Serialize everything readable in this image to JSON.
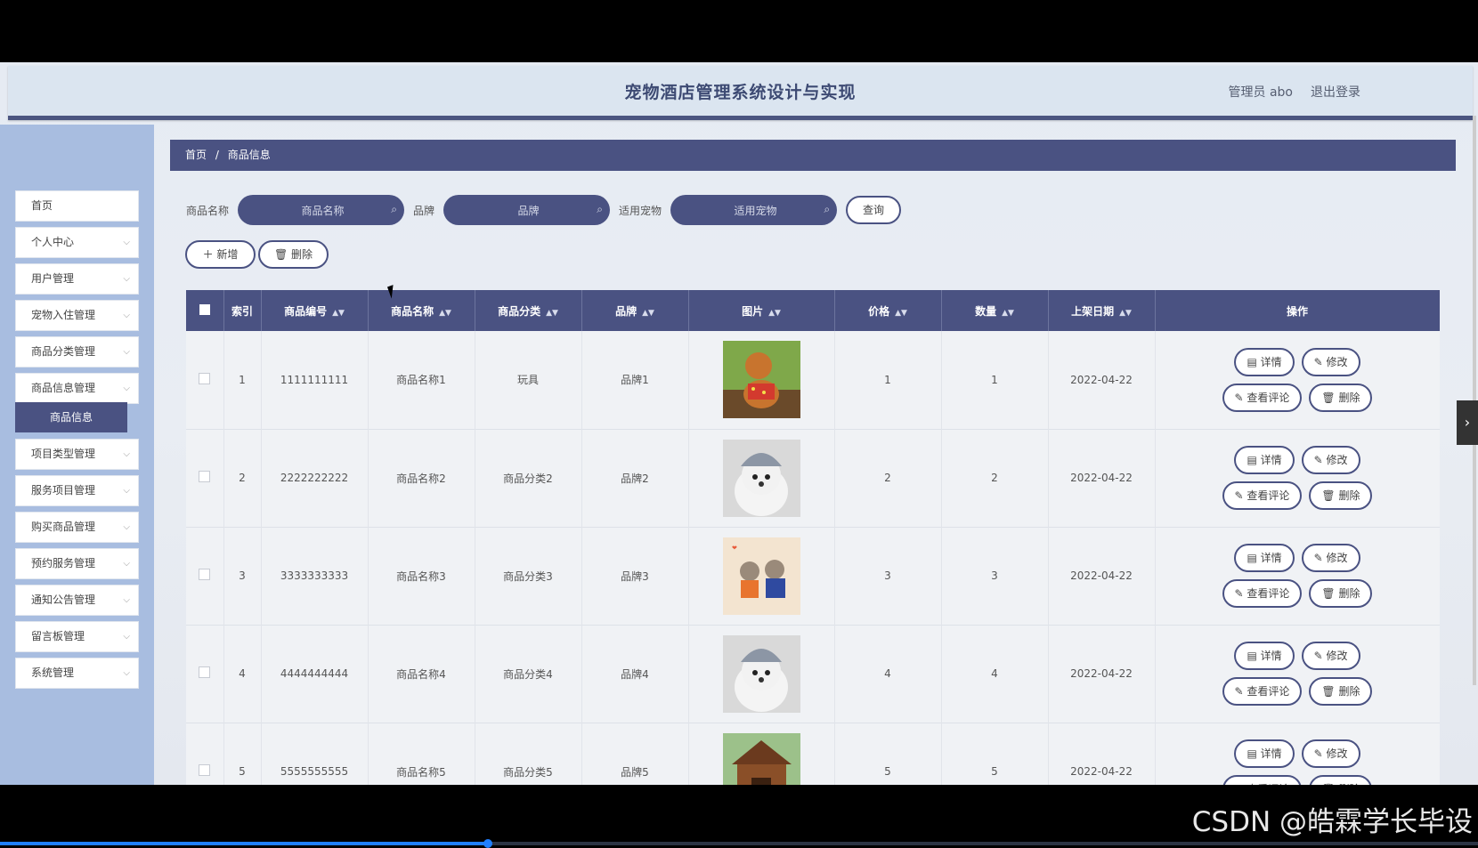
{
  "header": {
    "title": "宠物酒店管理系统设计与实现",
    "user": "管理员 abo",
    "logout": "退出登录"
  },
  "sidebar": {
    "items": [
      {
        "label": "首页",
        "has_children": false
      },
      {
        "label": "个人中心",
        "has_children": true
      },
      {
        "label": "用户管理",
        "has_children": true
      },
      {
        "label": "宠物入住管理",
        "has_children": true
      },
      {
        "label": "商品分类管理",
        "has_children": true
      },
      {
        "label": "商品信息管理",
        "has_children": true
      },
      {
        "label": "项目类型管理",
        "has_children": true
      },
      {
        "label": "服务项目管理",
        "has_children": true
      },
      {
        "label": "购买商品管理",
        "has_children": true
      },
      {
        "label": "预约服务管理",
        "has_children": true
      },
      {
        "label": "通知公告管理",
        "has_children": true
      },
      {
        "label": "留言板管理",
        "has_children": true
      },
      {
        "label": "系统管理",
        "has_children": true
      }
    ],
    "active_sub": "商品信息"
  },
  "breadcrumb": {
    "home": "首页",
    "separator": "/",
    "current": "商品信息"
  },
  "search": {
    "name_label": "商品名称",
    "name_placeholder": "商品名称",
    "brand_label": "品牌",
    "brand_placeholder": "品牌",
    "pet_label": "适用宠物",
    "pet_placeholder": "适用宠物",
    "query_button": "查询"
  },
  "actions": {
    "add": "新增",
    "delete": "删除"
  },
  "table": {
    "columns": [
      "索引",
      "商品编号",
      "商品名称",
      "商品分类",
      "品牌",
      "图片",
      "价格",
      "数量",
      "上架日期",
      "操作"
    ],
    "rows": [
      {
        "index": "1",
        "code": "1111111111",
        "name": "商品名称1",
        "category": "玩具",
        "brand": "品牌1",
        "image": "dog-in-vest",
        "price": "1",
        "quantity": "1",
        "date": "2022-04-22"
      },
      {
        "index": "2",
        "code": "2222222222",
        "name": "商品名称2",
        "category": "商品分类2",
        "brand": "品牌2",
        "image": "white-dog-beanie",
        "price": "2",
        "quantity": "2",
        "date": "2022-04-22"
      },
      {
        "index": "3",
        "code": "3333333333",
        "name": "商品名称3",
        "category": "商品分类3",
        "brand": "品牌3",
        "image": "two-dogs-clothes",
        "price": "3",
        "quantity": "3",
        "date": "2022-04-22"
      },
      {
        "index": "4",
        "code": "4444444444",
        "name": "商品名称4",
        "category": "商品分类4",
        "brand": "品牌4",
        "image": "white-dog-beanie",
        "price": "4",
        "quantity": "4",
        "date": "2022-04-22"
      },
      {
        "index": "5",
        "code": "5555555555",
        "name": "商品名称5",
        "category": "商品分类5",
        "brand": "品牌5",
        "image": "dog-house",
        "price": "5",
        "quantity": "5",
        "date": "2022-04-22"
      }
    ],
    "row_actions": {
      "detail": "详情",
      "edit": "修改",
      "comments": "查看评论",
      "delete": "删除"
    }
  },
  "watermark": "CSDN @皓霖学长毕设",
  "video_progress": 0.33
}
